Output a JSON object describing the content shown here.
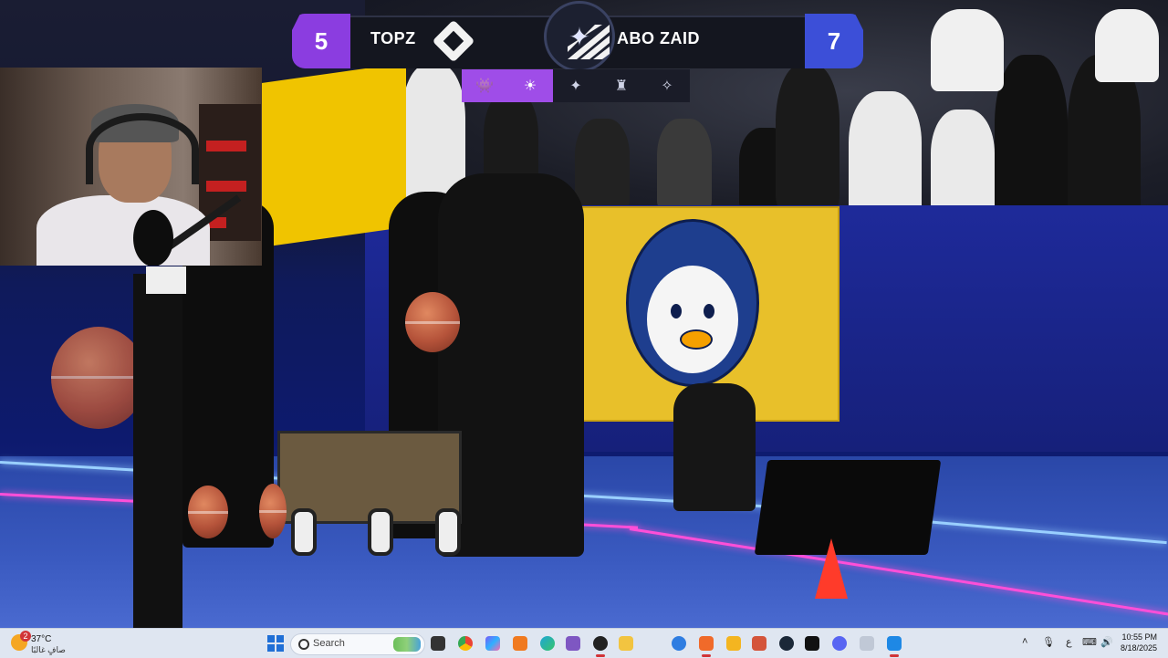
{
  "scoreboard": {
    "left_score": "5",
    "left_team": "TOPZ",
    "right_score": "7",
    "right_team": "ABO ZAID",
    "left_color": "#8b3de0",
    "right_color": "#3c4fd8",
    "round_icons": [
      {
        "icon": "space-invader-icon",
        "state": "active"
      },
      {
        "icon": "sun-badge-icon",
        "state": "active"
      },
      {
        "icon": "emblem-icon",
        "state": "current"
      },
      {
        "icon": "crest-icon",
        "state": "pending"
      },
      {
        "icon": "wing-logo-icon",
        "state": "pending"
      }
    ]
  },
  "taskbar": {
    "weather": {
      "temp": "37°C",
      "condition": "صافٍ غالبًا",
      "badge": "2"
    },
    "search_placeholder": "Search",
    "apps": [
      "task-view-icon",
      "chrome-icon",
      "copilot-icon",
      "affinity-icon",
      "edge-icon",
      "github-desktop-icon",
      "file-explorer-icon",
      "brave-icon",
      "vscode-icon",
      "nextcloud-icon",
      "app-icon",
      "steam-icon",
      "capcut-icon",
      "discord-icon",
      "bot-icon",
      "security-icon"
    ],
    "tray": {
      "lang": "ع"
    },
    "clock": {
      "time": "10:55 PM",
      "date": "8/18/2025"
    }
  }
}
